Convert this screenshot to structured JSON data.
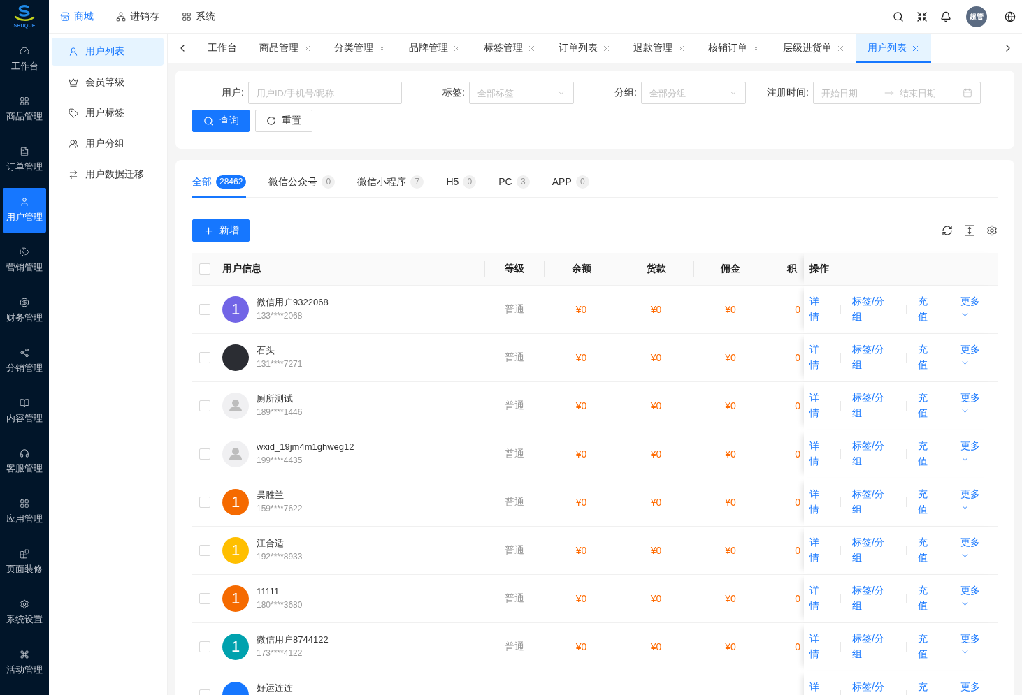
{
  "logo": {
    "text": "SHUQUE"
  },
  "nav": [
    {
      "label": "工作台",
      "selected": false
    },
    {
      "label": "商品管理",
      "selected": false
    },
    {
      "label": "订单管理",
      "selected": false
    },
    {
      "label": "用户管理",
      "selected": true
    },
    {
      "label": "营销管理",
      "selected": false
    },
    {
      "label": "财务管理",
      "selected": false
    },
    {
      "label": "分销管理",
      "selected": false
    },
    {
      "label": "内容管理",
      "selected": false
    },
    {
      "label": "客服管理",
      "selected": false
    },
    {
      "label": "应用管理",
      "selected": false
    },
    {
      "label": "页面装修",
      "selected": false
    },
    {
      "label": "系统设置",
      "selected": false
    },
    {
      "label": "活动管理",
      "selected": false
    }
  ],
  "top_menu": [
    {
      "label": "商城",
      "selected": true
    },
    {
      "label": "进销存",
      "selected": false
    },
    {
      "label": "系统",
      "selected": false
    }
  ],
  "user_avatar": {
    "text": "超管"
  },
  "sub_menu": [
    {
      "label": "用户列表",
      "selected": true
    },
    {
      "label": "会员等级",
      "selected": false
    },
    {
      "label": "用户标签",
      "selected": false
    },
    {
      "label": "用户分组",
      "selected": false
    },
    {
      "label": "用户数据迁移",
      "selected": false
    }
  ],
  "page_tabs": [
    {
      "label": "工作台",
      "closable": false,
      "selected": false
    },
    {
      "label": "商品管理",
      "closable": true,
      "selected": false
    },
    {
      "label": "分类管理",
      "closable": true,
      "selected": false
    },
    {
      "label": "品牌管理",
      "closable": true,
      "selected": false
    },
    {
      "label": "标签管理",
      "closable": true,
      "selected": false
    },
    {
      "label": "订单列表",
      "closable": true,
      "selected": false
    },
    {
      "label": "退款管理",
      "closable": true,
      "selected": false
    },
    {
      "label": "核销订单",
      "closable": true,
      "selected": false
    },
    {
      "label": "层级进货单",
      "closable": true,
      "selected": false
    },
    {
      "label": "用户列表",
      "closable": true,
      "selected": true
    }
  ],
  "filters": {
    "fields": [
      {
        "kind": "input",
        "label": "用户:",
        "placeholder": "用户ID/手机号/昵称"
      },
      {
        "kind": "select",
        "label": "标签:",
        "placeholder": "全部标签"
      },
      {
        "kind": "select",
        "label": "分组:",
        "placeholder": "全部分组"
      },
      {
        "kind": "date_range",
        "label": "注册时间:",
        "placeholder": "开始日期",
        "placeholder_end": "结束日期"
      }
    ],
    "buttons": [
      {
        "kind": "primary",
        "label": "查询"
      },
      {
        "kind": "default",
        "label": "重置"
      }
    ]
  },
  "source_tabs": [
    {
      "label": "全部",
      "count": "28462",
      "selected": true
    },
    {
      "label": "微信公众号",
      "count": "0",
      "selected": false
    },
    {
      "label": "微信小程序",
      "count": "7",
      "selected": false
    },
    {
      "label": "H5",
      "count": "0",
      "selected": false
    },
    {
      "label": "PC",
      "count": "3",
      "selected": false
    },
    {
      "label": "APP",
      "count": "0",
      "selected": false
    }
  ],
  "add_button": {
    "label": "新增"
  },
  "table": {
    "header_checked": false,
    "columns": [
      "用户信息",
      "等级",
      "余额",
      "货款",
      "佣金",
      "积",
      "操作"
    ],
    "rows": [
      {
        "checked": false,
        "avatar": {
          "kind": "letter",
          "text": "1",
          "color": "#7265e6"
        },
        "name": "微信用户9322068",
        "phone": "133****2068",
        "level": "普通",
        "balance": "¥0",
        "payment": "¥0",
        "commission": "¥0",
        "points": "0",
        "actions": [
          {
            "label": "详情",
            "kind": "link"
          },
          {
            "label": "标签/分组",
            "kind": "link"
          },
          {
            "label": "充值",
            "kind": "link"
          },
          {
            "label": "更多",
            "kind": "dropdown"
          }
        ]
      },
      {
        "checked": false,
        "avatar": {
          "kind": "photo"
        },
        "name": "石头",
        "phone": "131****7271",
        "level": "普通",
        "balance": "¥0",
        "payment": "¥0",
        "commission": "¥0",
        "points": "0",
        "actions": [
          {
            "label": "详情",
            "kind": "link"
          },
          {
            "label": "标签/分组",
            "kind": "link"
          },
          {
            "label": "充值",
            "kind": "link"
          },
          {
            "label": "更多",
            "kind": "dropdown"
          }
        ]
      },
      {
        "checked": false,
        "avatar": {
          "kind": "default"
        },
        "name": "厕所测试",
        "phone": "189****1446",
        "level": "普通",
        "balance": "¥0",
        "payment": "¥0",
        "commission": "¥0",
        "points": "0",
        "actions": [
          {
            "label": "详情",
            "kind": "link"
          },
          {
            "label": "标签/分组",
            "kind": "link"
          },
          {
            "label": "充值",
            "kind": "link"
          },
          {
            "label": "更多",
            "kind": "dropdown"
          }
        ]
      },
      {
        "checked": false,
        "avatar": {
          "kind": "default"
        },
        "name": "wxid_19jm4m1ghweg12",
        "phone": "199****4435",
        "level": "普通",
        "balance": "¥0",
        "payment": "¥0",
        "commission": "¥0",
        "points": "0",
        "actions": [
          {
            "label": "详情",
            "kind": "link"
          },
          {
            "label": "标签/分组",
            "kind": "link"
          },
          {
            "label": "充值",
            "kind": "link"
          },
          {
            "label": "更多",
            "kind": "dropdown"
          }
        ]
      },
      {
        "checked": false,
        "avatar": {
          "kind": "letter",
          "text": "1",
          "color": "#f56a00"
        },
        "name": "吴胜兰",
        "phone": "159****7622",
        "level": "普通",
        "balance": "¥0",
        "payment": "¥0",
        "commission": "¥0",
        "points": "0",
        "actions": [
          {
            "label": "详情",
            "kind": "link"
          },
          {
            "label": "标签/分组",
            "kind": "link"
          },
          {
            "label": "充值",
            "kind": "link"
          },
          {
            "label": "更多",
            "kind": "dropdown"
          }
        ]
      },
      {
        "checked": false,
        "avatar": {
          "kind": "letter",
          "text": "1",
          "color": "#ffbf00"
        },
        "name": "江合适",
        "phone": "192****8933",
        "level": "普通",
        "balance": "¥0",
        "payment": "¥0",
        "commission": "¥0",
        "points": "0",
        "actions": [
          {
            "label": "详情",
            "kind": "link"
          },
          {
            "label": "标签/分组",
            "kind": "link"
          },
          {
            "label": "充值",
            "kind": "link"
          },
          {
            "label": "更多",
            "kind": "dropdown"
          }
        ]
      },
      {
        "checked": false,
        "avatar": {
          "kind": "letter",
          "text": "1",
          "color": "#f56a00"
        },
        "name": "11111",
        "phone": "180****3680",
        "level": "普通",
        "balance": "¥0",
        "payment": "¥0",
        "commission": "¥0",
        "points": "0",
        "actions": [
          {
            "label": "详情",
            "kind": "link"
          },
          {
            "label": "标签/分组",
            "kind": "link"
          },
          {
            "label": "充值",
            "kind": "link"
          },
          {
            "label": "更多",
            "kind": "dropdown"
          }
        ]
      },
      {
        "checked": false,
        "avatar": {
          "kind": "letter",
          "text": "1",
          "color": "#00a2ae"
        },
        "name": "微信用户8744122",
        "phone": "173****4122",
        "level": "普通",
        "balance": "¥0",
        "payment": "¥0",
        "commission": "¥0",
        "points": "0",
        "actions": [
          {
            "label": "详情",
            "kind": "link"
          },
          {
            "label": "标签/分组",
            "kind": "link"
          },
          {
            "label": "充值",
            "kind": "link"
          },
          {
            "label": "更多",
            "kind": "dropdown"
          }
        ]
      },
      {
        "checked": false,
        "avatar": {
          "kind": "letter",
          "color": "#1677ff"
        },
        "name": "好运连连",
        "actions": [
          {
            "label": "详",
            "kind": "link"
          },
          {
            "label": "标签/分",
            "kind": "link"
          },
          {
            "label": "充",
            "kind": "link"
          },
          {
            "label": "更多",
            "kind": "link"
          }
        ]
      }
    ]
  }
}
